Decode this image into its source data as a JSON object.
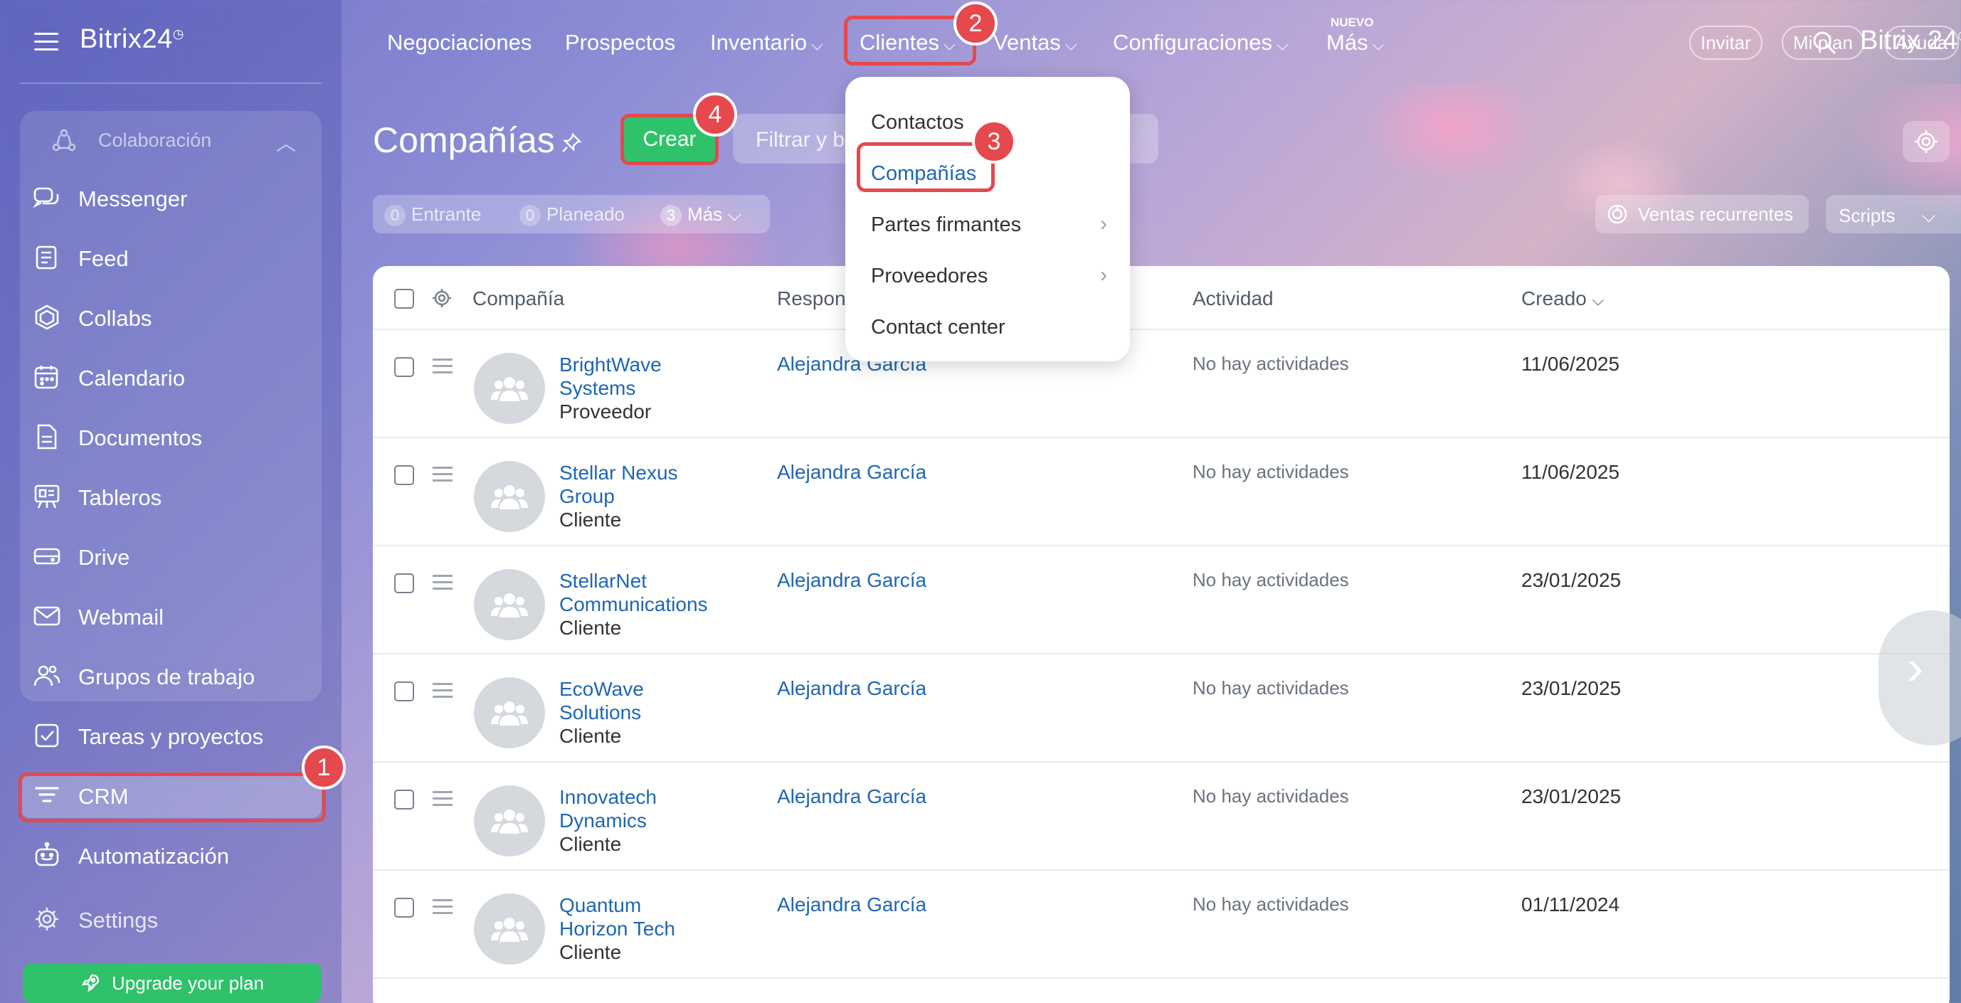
{
  "app": {
    "brand": "Bitrix24",
    "brand_mark": "◷"
  },
  "sidebar": {
    "group_title": "Colaboración",
    "items": [
      {
        "label": "Messenger",
        "icon": "chat-icon"
      },
      {
        "label": "Feed",
        "icon": "feed-icon"
      },
      {
        "label": "Collabs",
        "icon": "hexagon-icon"
      },
      {
        "label": "Calendario",
        "icon": "calendar-icon"
      },
      {
        "label": "Documentos",
        "icon": "document-icon"
      },
      {
        "label": "Tableros",
        "icon": "board-icon"
      },
      {
        "label": "Drive",
        "icon": "drive-icon"
      },
      {
        "label": "Webmail",
        "icon": "mail-icon"
      },
      {
        "label": "Grupos de trabajo",
        "icon": "group-icon"
      },
      {
        "label": "Tareas y proyectos",
        "icon": "task-icon"
      },
      {
        "label": "CRM",
        "icon": "funnel-icon"
      },
      {
        "label": "Automatización",
        "icon": "robot-icon"
      },
      {
        "label": "Settings",
        "icon": "gear-icon"
      }
    ],
    "upgrade_label": "Upgrade your plan"
  },
  "topnav": {
    "items": [
      "Negociaciones",
      "Prospectos",
      "Inventario",
      "Clientes",
      "Ventas",
      "Configuraciones",
      "Más"
    ],
    "nuevo_badge": "NUEVO",
    "brand": "Bitrix 24",
    "invite": "Invitar",
    "myplan": "Mi plan",
    "help": "Ayuda"
  },
  "page": {
    "title": "Compañías",
    "create_label": "Crear",
    "filter_placeholder": "Filtrar y buscar",
    "counters": [
      {
        "num": "0",
        "label": "Entrante"
      },
      {
        "num": "0",
        "label": "Planeado"
      },
      {
        "num": "3",
        "label": "Más"
      }
    ],
    "recurring_sales": "Ventas recurrentes",
    "scripts": "Scripts"
  },
  "dropdown": {
    "items": [
      "Contactos",
      "Compañías",
      "Partes firmantes",
      "Proveedores",
      "Contact center"
    ]
  },
  "table": {
    "columns": [
      "Compañía",
      "Responsable",
      "Actividad",
      "Creado"
    ],
    "rows": [
      {
        "name": "BrightWave Systems",
        "type": "Proveedor",
        "responsible": "Alejandra García",
        "activity": "No hay actividades",
        "created": "11/06/2025"
      },
      {
        "name": "Stellar Nexus Group",
        "type": "Cliente",
        "responsible": "Alejandra García",
        "activity": "No hay actividades",
        "created": "11/06/2025"
      },
      {
        "name": "StellarNet Communications",
        "type": "Cliente",
        "responsible": "Alejandra García",
        "activity": "No hay actividades",
        "created": "23/01/2025"
      },
      {
        "name": "EcoWave Solutions",
        "type": "Cliente",
        "responsible": "Alejandra García",
        "activity": "No hay actividades",
        "created": "23/01/2025"
      },
      {
        "name": "Innovatech Dynamics",
        "type": "Cliente",
        "responsible": "Alejandra García",
        "activity": "No hay actividades",
        "created": "23/01/2025"
      },
      {
        "name": "Quantum Horizon Tech",
        "type": "Cliente",
        "responsible": "Alejandra García",
        "activity": "No hay actividades",
        "created": "01/11/2024"
      }
    ]
  },
  "annotations": [
    "1",
    "2",
    "3",
    "4"
  ],
  "colors": {
    "accent_green": "#2fc26b",
    "link_blue": "#1f66b3",
    "annotation_red": "#e5484d"
  }
}
